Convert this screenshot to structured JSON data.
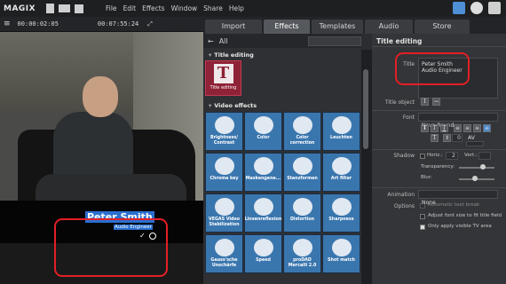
{
  "app": {
    "logo": "MAGIX",
    "menu": [
      "File",
      "Edit",
      "Effects",
      "Window",
      "Share",
      "Help"
    ]
  },
  "player": {
    "timecode_left": "00:00:02:05",
    "timecode_right": "00:07:55:24"
  },
  "video_title": {
    "name": "Peter Smith",
    "role": "Audio Engineer"
  },
  "tabs": [
    "Import",
    "Effects",
    "Templates",
    "Audio",
    "Store"
  ],
  "effects": {
    "filter_label": "All",
    "section_title": "Title editing",
    "title_tile": "Title editing",
    "section_video": "Video effects",
    "tiles": [
      {
        "label": "Brightness/ Contrast",
        "icon": "brightness-icon"
      },
      {
        "label": "Color",
        "icon": "palette-icon"
      },
      {
        "label": "Color correction",
        "icon": "color-correction-icon"
      },
      {
        "label": "Leuchten",
        "icon": "glow-icon"
      },
      {
        "label": "Chroma key",
        "icon": "chroma-key-icon"
      },
      {
        "label": "Maskengene...",
        "icon": "mask-icon"
      },
      {
        "label": "Stanzformen",
        "icon": "shapes-icon"
      },
      {
        "label": "Art filter",
        "icon": "art-filter-icon"
      },
      {
        "label": "VEGAS Video Stabilization",
        "icon": "stabilization-icon"
      },
      {
        "label": "Linsenreflexion",
        "icon": "lens-flare-icon"
      },
      {
        "label": "Distortion",
        "icon": "distortion-icon"
      },
      {
        "label": "Sharpness",
        "icon": "sharpness-icon"
      },
      {
        "label": "Gauss'sche Unschärfe",
        "icon": "blur-drop-icon"
      },
      {
        "label": "Speed",
        "icon": "speed-icon"
      },
      {
        "label": "proDAD Mercalli 2.0",
        "icon": "mercalli-icon"
      },
      {
        "label": "Shot match",
        "icon": "shot-match-icon"
      }
    ]
  },
  "title_editing": {
    "header": "Title editing",
    "title_label": "Title",
    "title_value_line1": "Peter Smith",
    "title_value_line2": "Audio Engineer",
    "object_label": "Title object",
    "font_label": "Font",
    "font_value": "Nova Round",
    "size_value": "0",
    "av_label": "AV",
    "shadow_label": "Shadow",
    "horiz_label": "Horiz.:",
    "horiz_value": "2",
    "vert_label": "Vert.:",
    "transparency_label": "Transparency:",
    "blur_label": "Blur:",
    "animation_label": "Animation",
    "animation_value": "None",
    "options_label": "Options",
    "opt1": "Automatic text break",
    "opt2": "Adjust font size to fit title field",
    "opt3": "Only apply visible TV area"
  }
}
